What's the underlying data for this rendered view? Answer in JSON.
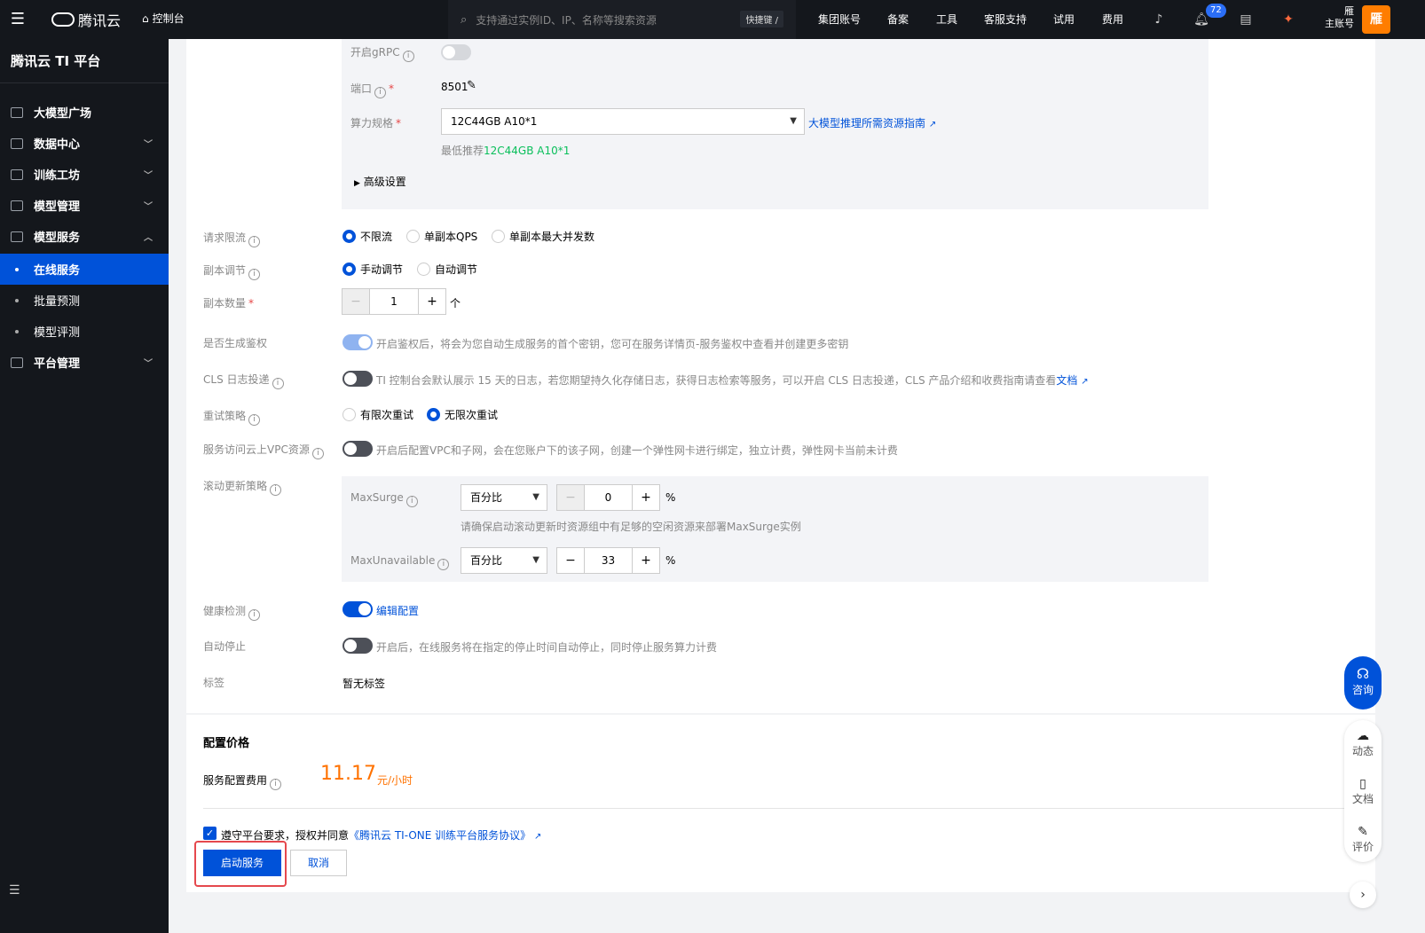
{
  "topbar": {
    "brand": "腾讯云",
    "console": "控制台",
    "search_placeholder": "支持通过实例ID、IP、名称等搜索资源",
    "shortcut": "快捷键 /",
    "nav": [
      "集团账号",
      "备案",
      "工具",
      "客服支持",
      "试用",
      "费用"
    ],
    "notifications": "72",
    "account_line1": "雁",
    "account_line2": "主账号",
    "avatar": "雁"
  },
  "sidebar": {
    "title": "腾讯云 TI 平台",
    "items": [
      {
        "label": "大模型广场",
        "icon": "square-grid-icon"
      },
      {
        "label": "数据中心",
        "icon": "calendar-icon"
      },
      {
        "label": "训练工坊",
        "icon": "monitor-icon"
      },
      {
        "label": "模型管理",
        "icon": "cube-icon"
      },
      {
        "label": "模型服务",
        "icon": "document-icon"
      }
    ],
    "subitems": [
      "在线服务",
      "批量预测",
      "模型评测"
    ],
    "platform": "平台管理"
  },
  "form": {
    "grpc_label": "开启gRPC",
    "port_label": "端口",
    "port_value": "8501",
    "compute_label": "算力规格",
    "compute_value": "12C44GB A10*1",
    "compute_guide": "大模型推理所需资源指南",
    "min_rec_prefix": "最低推荐",
    "min_rec_value": "12C44GB A10*1",
    "advanced": "高级设置",
    "rate_limit_label": "请求限流",
    "rate_options": [
      "不限流",
      "单副本QPS",
      "单副本最大并发数"
    ],
    "replica_adjust_label": "副本调节",
    "replica_adjust_options": [
      "手动调节",
      "自动调节"
    ],
    "replica_count_label": "副本数量",
    "replica_count": "1",
    "replica_unit": "个",
    "auth_label": "是否生成鉴权",
    "auth_desc": "开启鉴权后，将会为您自动生成服务的首个密钥，您可在服务详情页-服务鉴权中查看并创建更多密钥",
    "cls_label": "CLS 日志投递",
    "cls_desc": "TI 控制台会默认展示 15 天的日志，若您期望持久化存储日志，获得日志检索等服务，可以开启 CLS 日志投递，CLS 产品介绍和收费指南请查看",
    "cls_link": "文档",
    "retry_label": "重试策略",
    "retry_options": [
      "有限次重试",
      "无限次重试"
    ],
    "vpc_label": "服务访问云上VPC资源",
    "vpc_desc": "开启后配置VPC和子网，会在您账户下的该子网，创建一个弹性网卡进行绑定，独立计费，弹性网卡当前未计费",
    "rolling_label": "滚动更新策略",
    "maxsurge_label": "MaxSurge",
    "maxsurge_type": "百分比",
    "maxsurge_value": "0",
    "maxsurge_hint": "请确保启动滚动更新时资源组中有足够的空闲资源来部署MaxSurge实例",
    "maxunavail_label": "MaxUnavailable",
    "maxunavail_type": "百分比",
    "maxunavail_value": "33",
    "percent": "%",
    "health_label": "健康检测",
    "health_link": "编辑配置",
    "autostop_label": "自动停止",
    "autostop_desc": "开启后，在线服务将在指定的停止时间自动停止，同时停止服务算力计费",
    "tags_label": "标签",
    "tags_value": "暂无标签"
  },
  "pricing": {
    "title": "配置价格",
    "fee_label": "服务配置费用",
    "price": "11.17",
    "unit": "元/小时"
  },
  "agreement": {
    "prefix": "遵守平台要求，授权并同意",
    "link": "《腾讯云 TI-ONE 训练平台服务协议》"
  },
  "actions": {
    "start": "启动服务",
    "cancel": "取消"
  },
  "floating": {
    "consult": "咨询",
    "dynamic": "动态",
    "docs": "文档",
    "review": "评价"
  }
}
